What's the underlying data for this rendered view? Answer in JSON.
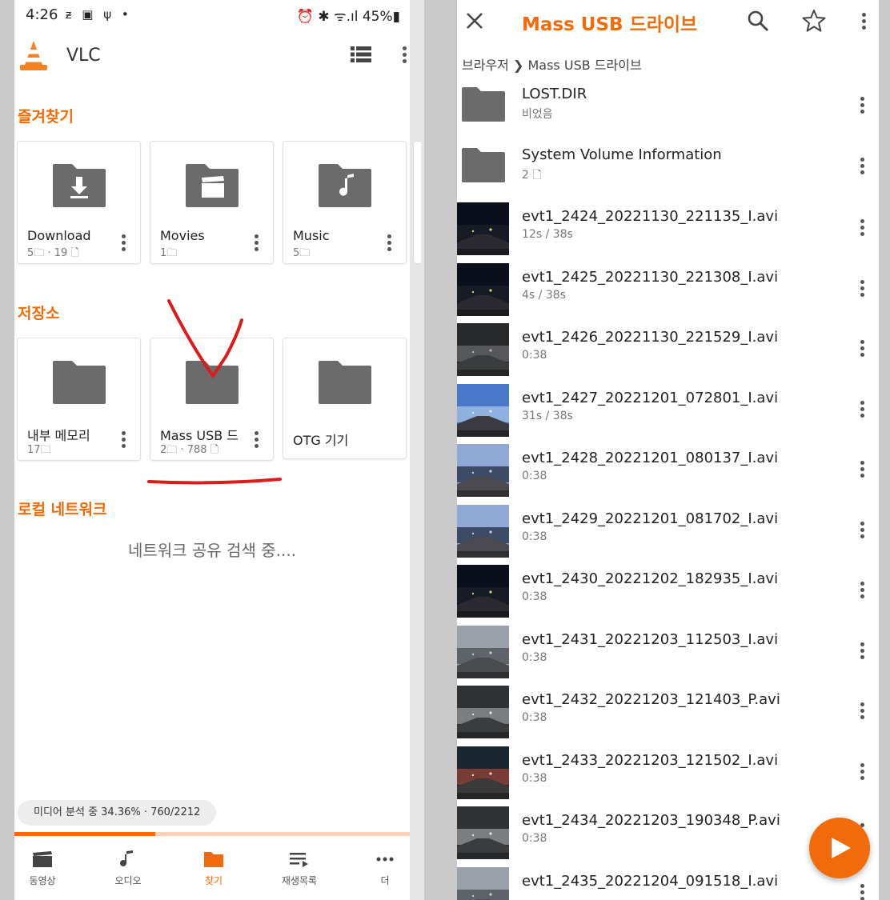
{
  "left": {
    "status": {
      "time": "4:26",
      "icons": "ᵶ ▣ ψ •",
      "right": "⏰ ✱ ᯤ.ıl 45%▮"
    },
    "app_title": "VLC",
    "favorites": {
      "title": "즐겨찾기",
      "tiles": [
        {
          "name": "Download",
          "folders": "5",
          "files": "19",
          "icon": "download-folder-icon"
        },
        {
          "name": "Movies",
          "folders": "1",
          "files": "",
          "icon": "movie-folder-icon"
        },
        {
          "name": "Music",
          "folders": "5",
          "files": "",
          "icon": "music-folder-icon"
        }
      ]
    },
    "storage": {
      "title": "저장소",
      "tiles": [
        {
          "name": "내부 메모리",
          "folders": "17",
          "files": ""
        },
        {
          "name": "Mass USB 드라이브",
          "folders": "2",
          "files": "788"
        },
        {
          "name": "OTG 기기",
          "folders": "",
          "files": ""
        }
      ]
    },
    "network": {
      "title": "로컬 네트워크",
      "searching": "네트워크 공유 검색 중...."
    },
    "media_scan": {
      "text": "미디어 분석 중 34.36% · 760/2212",
      "progress": 0.3436
    },
    "bottom_nav": [
      "동영상",
      "오디오",
      "찾기",
      "재생목록",
      "더"
    ],
    "active_tab": 2,
    "accent": "#f26b0a"
  },
  "right": {
    "title": "Mass USB 드라이브",
    "breadcrumb": {
      "root": "브라우저",
      "current": "Mass USB 드라이브"
    },
    "folders": [
      {
        "name": "LOST.DIR",
        "meta": "비었음"
      },
      {
        "name": "System Volume Information",
        "meta": "2"
      }
    ],
    "videos": [
      {
        "name": "evt1_2424_20221130_221135_I.avi",
        "meta": "12s / 38s",
        "scene": "night"
      },
      {
        "name": "evt1_2425_20221130_221308_I.avi",
        "meta": "4s / 38s",
        "scene": "night"
      },
      {
        "name": "evt1_2426_20221130_221529_I.avi",
        "meta": "0:38",
        "scene": "tunnel"
      },
      {
        "name": "evt1_2427_20221201_072801_I.avi",
        "meta": "31s / 38s",
        "scene": "dawn"
      },
      {
        "name": "evt1_2428_20221201_080137_I.avi",
        "meta": "0:38",
        "scene": "city"
      },
      {
        "name": "evt1_2429_20221201_081702_I.avi",
        "meta": "0:38",
        "scene": "city"
      },
      {
        "name": "evt1_2430_20221202_182935_I.avi",
        "meta": "0:38",
        "scene": "night"
      },
      {
        "name": "evt1_2431_20221203_112503_I.avi",
        "meta": "0:38",
        "scene": "day"
      },
      {
        "name": "evt1_2432_20221203_121403_P.avi",
        "meta": "0:38",
        "scene": "garage"
      },
      {
        "name": "evt1_2433_20221203_121502_I.avi",
        "meta": "0:38",
        "scene": "street"
      },
      {
        "name": "evt1_2434_20221203_190348_P.avi",
        "meta": "0:38",
        "scene": "garage"
      },
      {
        "name": "evt1_2435_20221204_091518_I.avi",
        "meta": "",
        "scene": "day"
      }
    ]
  }
}
